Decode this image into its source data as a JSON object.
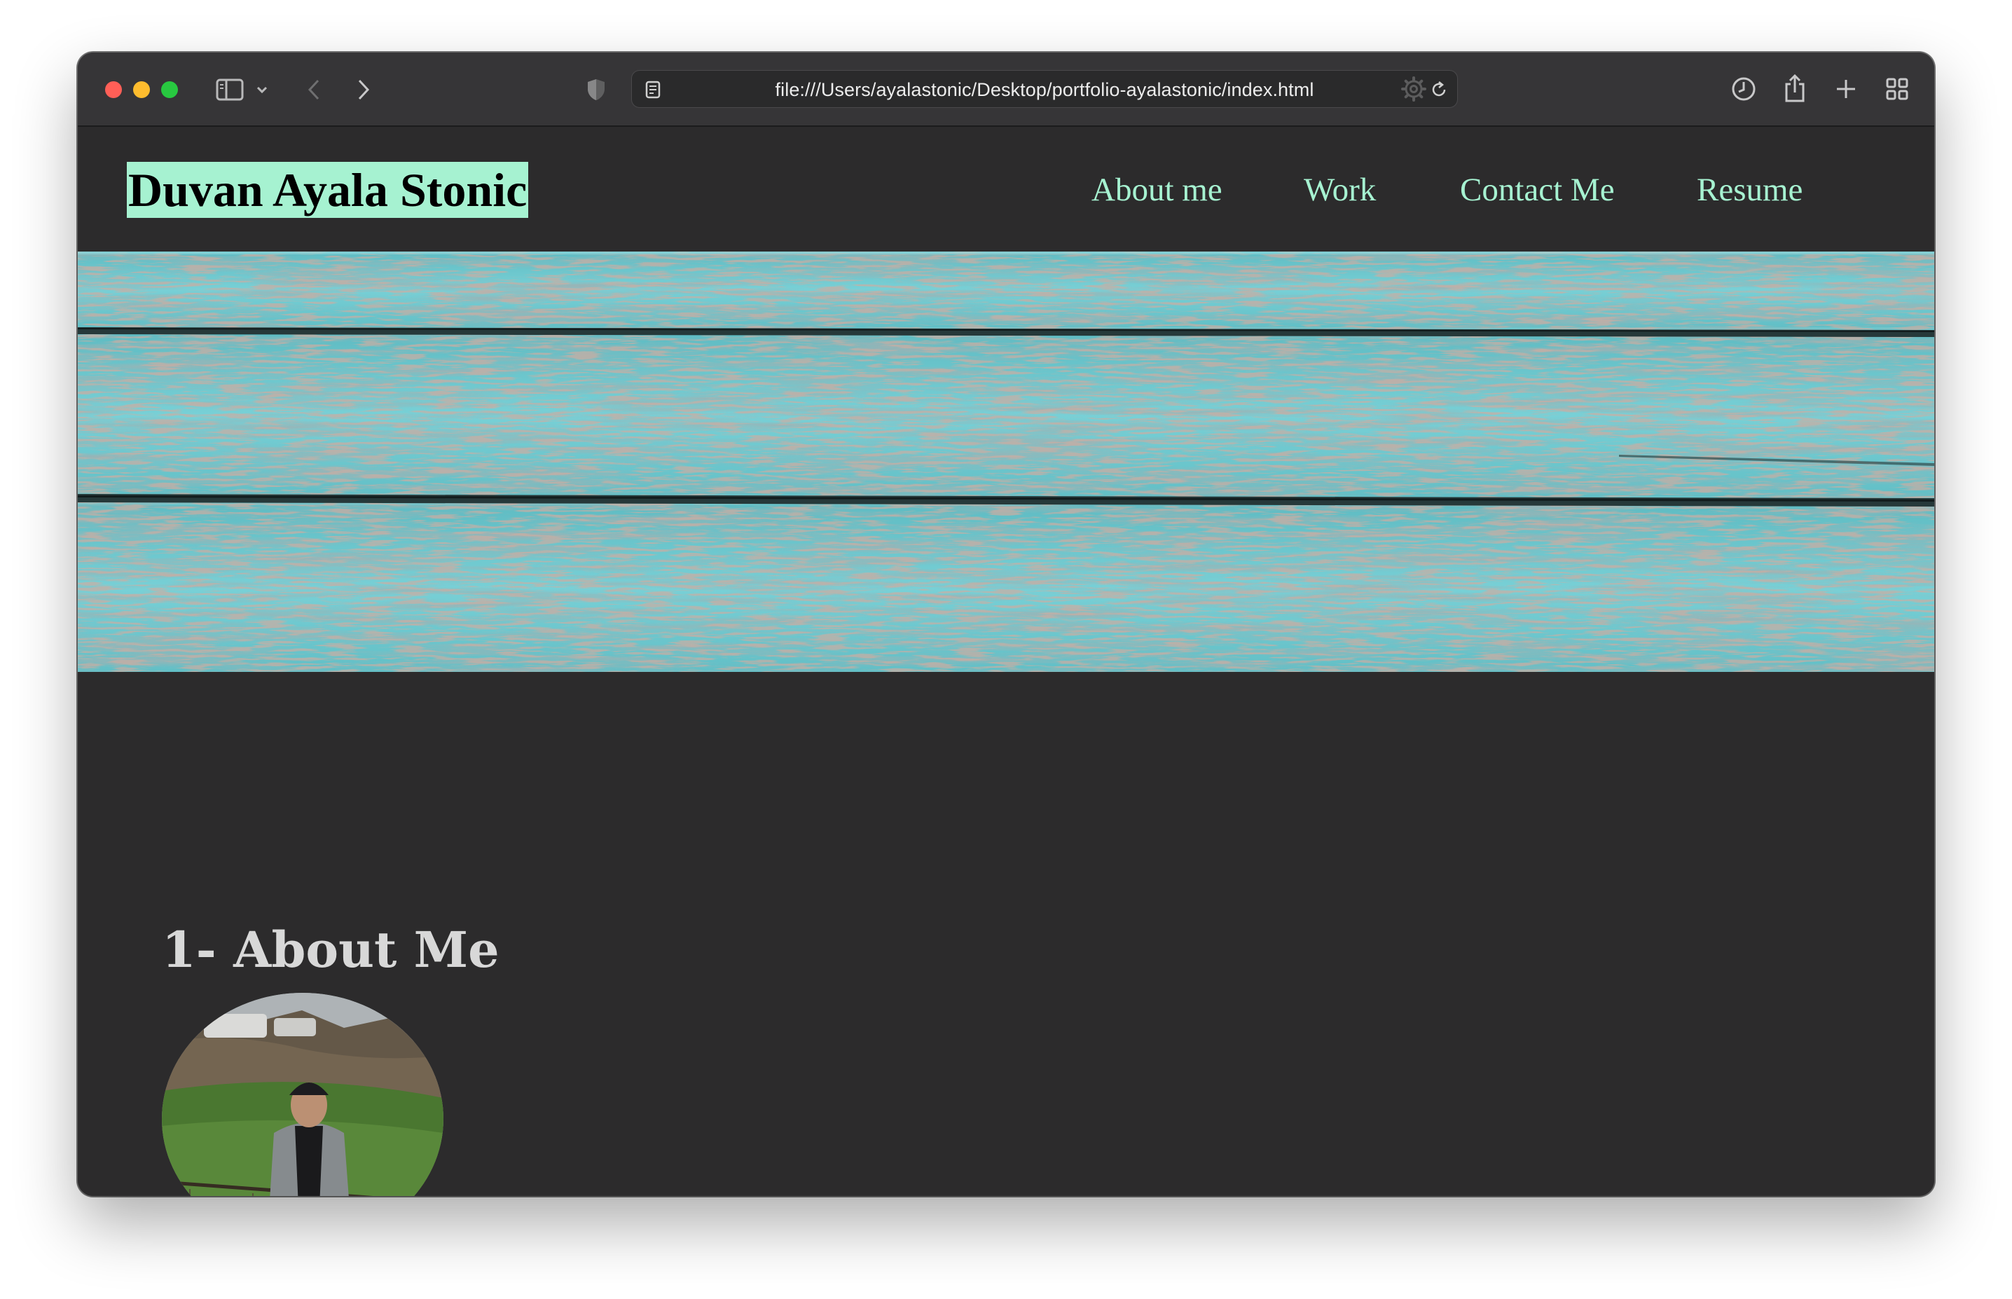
{
  "browser": {
    "url": "file:///Users/ayalastonic/Desktop/portfolio-ayalastonic/index.html",
    "traffic_lights": {
      "close": "#ff5f57",
      "minimize": "#febc2e",
      "zoom": "#28c840"
    },
    "icons": [
      "sidebar-icon",
      "chevron-down-icon",
      "back-icon",
      "forward-icon",
      "shield-icon",
      "page-icon",
      "reload-icon",
      "gear-icon",
      "history-icon",
      "share-icon",
      "plus-icon",
      "tab-overview-icon"
    ]
  },
  "site": {
    "logo": "Duvan Ayala Stonic",
    "nav": [
      {
        "label": "About me"
      },
      {
        "label": "Work"
      },
      {
        "label": "Contact Me"
      },
      {
        "label": "Resume"
      }
    ],
    "section_title": "1- About Me"
  },
  "colors": {
    "page_background": "#2c2b2c",
    "accent": "#a6f2d1",
    "hero_wood": "#6cc7cd"
  }
}
